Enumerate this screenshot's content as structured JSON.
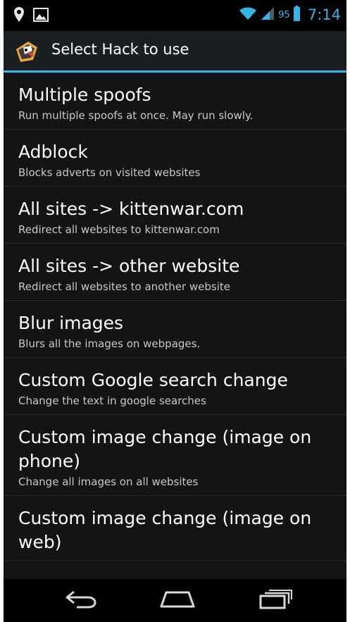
{
  "status_bar": {
    "battery_level": "95",
    "clock": "7:14",
    "icons": [
      "location-pin-icon",
      "image-icon",
      "wifi-icon",
      "signal-icon",
      "battery-icon"
    ]
  },
  "action_bar": {
    "title": "Select Hack to use",
    "icon": "app-logo-icon"
  },
  "list": {
    "items": [
      {
        "title": "Multiple spoofs",
        "subtitle": "Run multiple spoofs at once. May run slowly."
      },
      {
        "title": "Adblock",
        "subtitle": "Blocks adverts on visited websites"
      },
      {
        "title": "All sites -> kittenwar.com",
        "subtitle": "Redirect all websites to kittenwar.com"
      },
      {
        "title": "All sites -> other website",
        "subtitle": "Redirect all websites to another website"
      },
      {
        "title": "Blur images",
        "subtitle": "Blurs all the images on webpages."
      },
      {
        "title": "Custom Google search change",
        "subtitle": "Change the text in google searches"
      },
      {
        "title": "Custom image change (image on phone)",
        "subtitle": "Change all images on all websites"
      },
      {
        "title": "Custom image change (image on web)",
        "subtitle": ""
      }
    ]
  },
  "nav_bar": {
    "buttons": [
      "back-icon",
      "home-icon",
      "recent-apps-icon"
    ]
  },
  "colors": {
    "accent": "#33b5e5",
    "background": "#121416",
    "text_primary": "#ffffff",
    "text_secondary": "#c8c8c8"
  }
}
